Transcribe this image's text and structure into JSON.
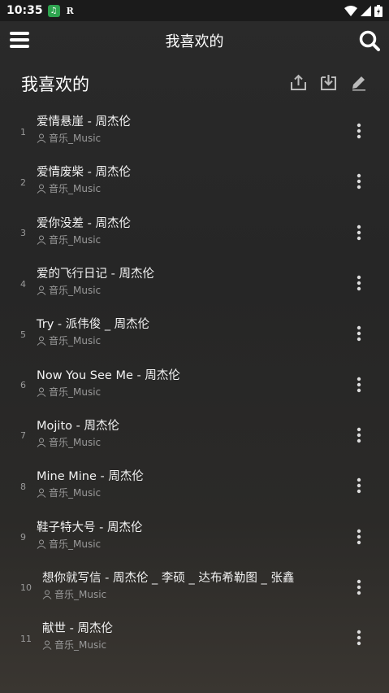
{
  "status_bar": {
    "time": "10:35",
    "r_label": "R"
  },
  "app_bar": {
    "title": "我喜欢的"
  },
  "header": {
    "title": "我喜欢的"
  },
  "songs": [
    {
      "index": "1",
      "title": "爱情悬崖 - 周杰伦",
      "artist": "音乐_Music"
    },
    {
      "index": "2",
      "title": "爱情废柴 - 周杰伦",
      "artist": "音乐_Music"
    },
    {
      "index": "3",
      "title": "爱你没差 - 周杰伦",
      "artist": "音乐_Music"
    },
    {
      "index": "4",
      "title": "爱的飞行日记 - 周杰伦",
      "artist": "音乐_Music"
    },
    {
      "index": "5",
      "title": "Try - 派伟俊 _ 周杰伦",
      "artist": "音乐_Music"
    },
    {
      "index": "6",
      "title": "Now You See Me - 周杰伦",
      "artist": "音乐_Music"
    },
    {
      "index": "7",
      "title": "Mojito - 周杰伦",
      "artist": "音乐_Music"
    },
    {
      "index": "8",
      "title": "Mine Mine - 周杰伦",
      "artist": "音乐_Music"
    },
    {
      "index": "9",
      "title": "鞋子特大号 - 周杰伦",
      "artist": "音乐_Music"
    },
    {
      "index": "10",
      "title": "想你就写信 - 周杰伦 _ 李硕 _ 达布希勒图 _ 张鑫",
      "artist": "音乐_Music"
    },
    {
      "index": "11",
      "title": "献世 - 周杰伦",
      "artist": "音乐_Music"
    }
  ],
  "icons": {
    "menu": "menu-icon",
    "search": "search-icon",
    "share": "share-icon",
    "download": "download-icon",
    "edit": "edit-icon",
    "more": "more-vertical-icon",
    "person": "person-icon"
  },
  "colors": {
    "status_app_icon": "#2ea44f",
    "background": "#262626",
    "secondary_text": "#9a9a9a"
  }
}
